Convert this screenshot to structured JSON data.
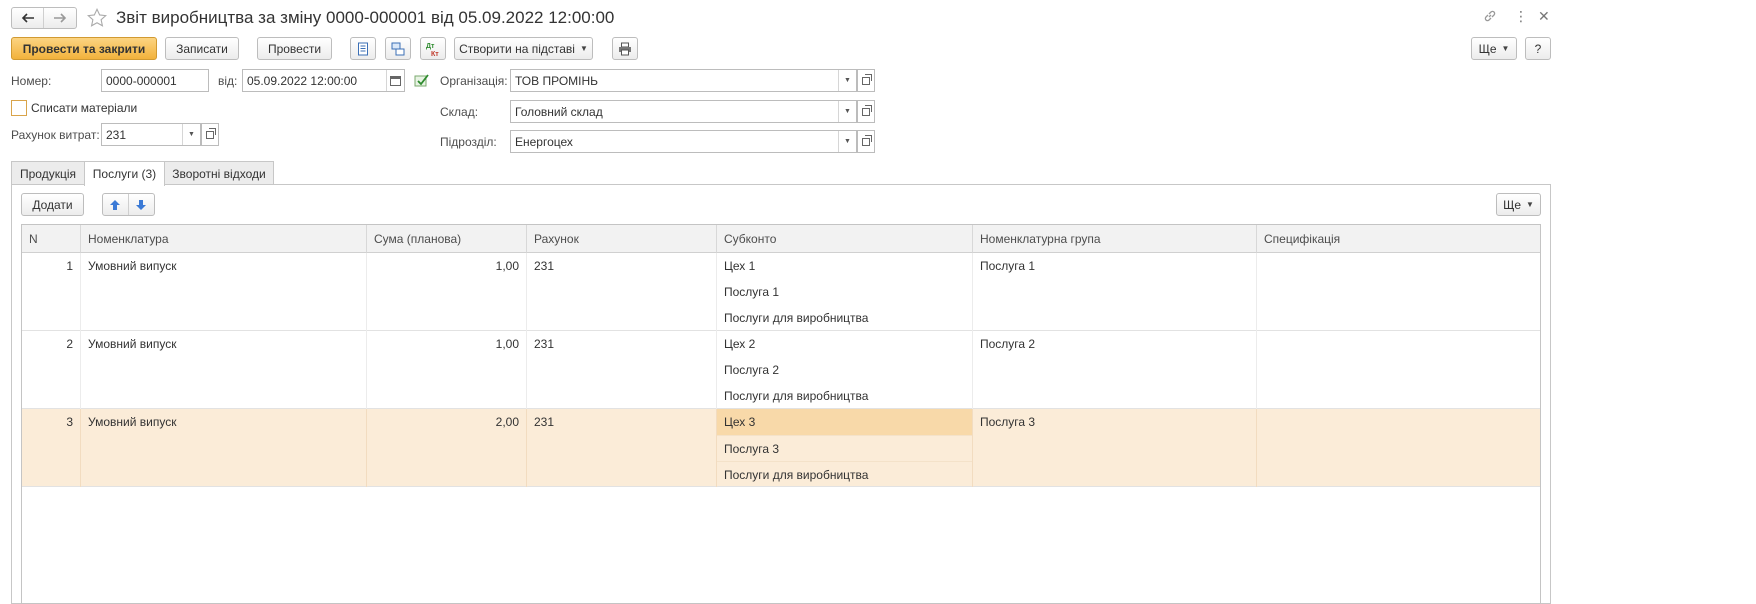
{
  "window": {
    "title": "Звіт виробництва за зміну 0000-000001 від 05.09.2022 12:00:00"
  },
  "toolbar": {
    "post_and_close": "Провести та закрити",
    "save": "Записати",
    "post": "Провести",
    "create_based_on": "Створити на підставі",
    "more": "Ще",
    "help": "?"
  },
  "header": {
    "number_label": "Номер:",
    "number_value": "0000-000001",
    "date_label": "від:",
    "date_value": "05.09.2022 12:00:00",
    "org_label": "Організація:",
    "org_value": "ТОВ ПРОМІНЬ",
    "writeoff_label": "Списати  матеріали",
    "writeoff_checked": false,
    "warehouse_label": "Склад:",
    "warehouse_value": "Головний склад",
    "cost_account_label": "Рахунок витрат:",
    "cost_account_value": "231",
    "department_label": "Підрозділ:",
    "department_value": "Енергоцех"
  },
  "tabs": [
    {
      "label": "Продукція",
      "active": false
    },
    {
      "label": "Послуги (3)",
      "active": true
    },
    {
      "label": "Зворотні відходи",
      "active": false
    }
  ],
  "table_toolbar": {
    "add": "Додати",
    "more": "Ще"
  },
  "table": {
    "columns": [
      "N",
      "Номенклатура",
      "Сума (планова)",
      "Рахунок",
      "Субконто",
      "Номенклатурна група",
      "Специфікація"
    ],
    "rows": [
      {
        "n": "1",
        "item": "Умовний випуск",
        "sum": "1,00",
        "account": "231",
        "subconto": [
          "Цех 1",
          "Послуга 1",
          "Послуги для виробництва"
        ],
        "group": "Послуга 1",
        "spec": ""
      },
      {
        "n": "2",
        "item": "Умовний випуск",
        "sum": "1,00",
        "account": "231",
        "subconto": [
          "Цех 2",
          "Послуга 2",
          "Послуги для виробництва"
        ],
        "group": "Послуга 2",
        "spec": ""
      },
      {
        "n": "3",
        "item": "Умовний випуск",
        "sum": "2,00",
        "account": "231",
        "subconto": [
          "Цех 3",
          "Послуга 3",
          "Послуги для виробництва"
        ],
        "group": "Послуга 3",
        "spec": ""
      }
    ]
  },
  "colors": {
    "primary_button": "#f2b23c",
    "selected_row": "#fbecd8",
    "selected_cell": "#f8d9a9"
  }
}
